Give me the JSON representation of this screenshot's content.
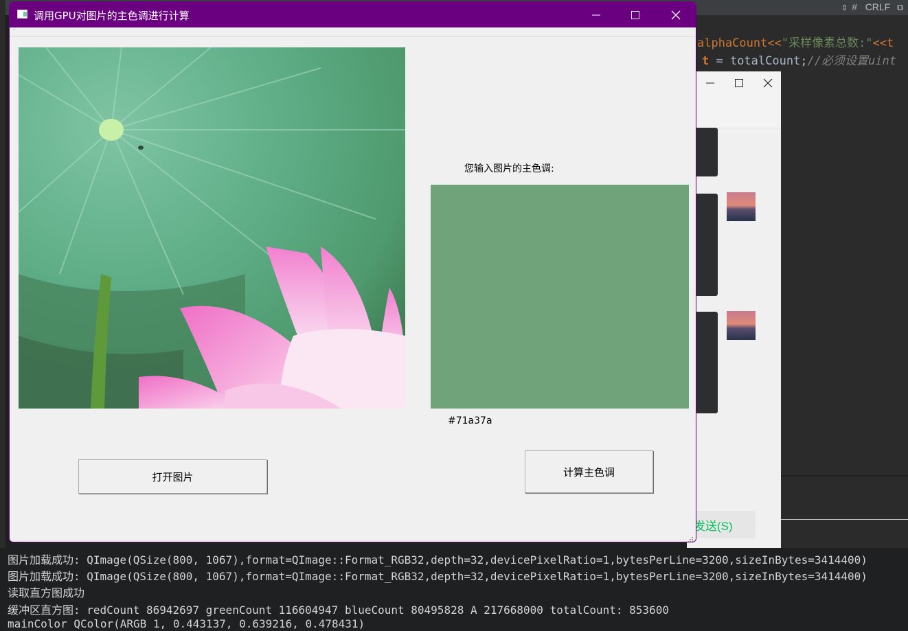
{
  "window": {
    "title": "调用GPU对图片的主色调进行计算",
    "minimize_icon": "minimize-icon",
    "maximize_icon": "maximize-icon",
    "close_icon": "close-icon",
    "menu_glyph": ":"
  },
  "main": {
    "prompt_label": "您输入图片的主色调:",
    "swatch_color": "#71a37a",
    "hex_value": "#71a37a",
    "open_button": "打开图片",
    "calc_button": "计算主色调"
  },
  "ide": {
    "status_hash": "#",
    "status_crlf": "CRLF",
    "code_line_1_a": "alphaCount<<",
    "code_line_1_b": "\"采样像素总数:\"",
    "code_line_1_c": "<<t",
    "code_line_2_a": "t",
    "code_line_2_b": " = totalCount;",
    "code_line_2_c": "//必须设置uint"
  },
  "chat": {
    "send_label": "发送(S)"
  },
  "console": {
    "lines": [
      "图片加载成功: QImage(QSize(800, 1067),format=QImage::Format_RGB32,depth=32,devicePixelRatio=1,bytesPerLine=3200,sizeInBytes=3414400)",
      "图片加载成功: QImage(QSize(800, 1067),format=QImage::Format_RGB32,depth=32,devicePixelRatio=1,bytesPerLine=3200,sizeInBytes=3414400)",
      "读取直方图成功",
      "缓冲区直方图:  redCount 86942697 greenCount 116604947 blueCount 80495828 A 217668000 totalCount: 853600",
      "mainColor QColor(ARGB 1, 0.443137, 0.639216, 0.478431)"
    ]
  },
  "colors": {
    "titlebar": "#6a0080",
    "ide_bg": "#2b2b2b",
    "accent_green": "#07c160"
  }
}
